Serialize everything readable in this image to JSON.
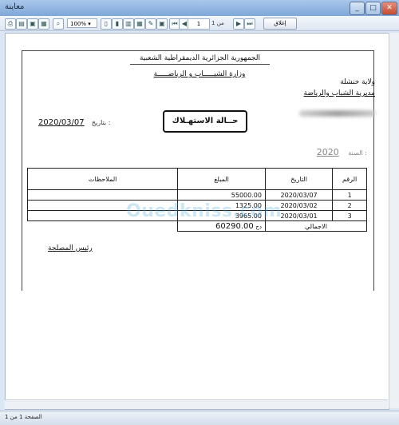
{
  "window": {
    "title": "معاينة",
    "controls": {
      "minimize": "_",
      "maximize": "□",
      "close": "✕"
    }
  },
  "toolbar": {
    "zoom": "100%",
    "page_current": "1",
    "page_of_label": "من 1",
    "close_label": "إغلاق"
  },
  "report": {
    "header_line1": "الجمهورية الجزائرية الديمقراطية الشعبية",
    "header_line2": "وزارة الشبـــــاب و الرياضـــــة",
    "wilaya": "ولاية خنشلة",
    "directorate": "مديرية الشباب والرياضة",
    "title": "حــالة الاستهـلاك",
    "date_label": "بتاريخ :",
    "date_value": "2020/03/07",
    "year_label": "السنة :",
    "year_value": "2020",
    "columns": {
      "num": "الرقم",
      "date": "التاريخ",
      "amount": "المبلغ",
      "notes": "الملاحظات"
    },
    "rows": [
      {
        "num": "1",
        "date": "2020/03/07",
        "amount": "55000.00",
        "notes": ""
      },
      {
        "num": "2",
        "date": "2020/03/02",
        "amount": "1325.00",
        "notes": ""
      },
      {
        "num": "3",
        "date": "2020/03/01",
        "amount": "3965.00",
        "notes": ""
      }
    ],
    "total_label": "الاجمالي",
    "total_value": "60290.00",
    "currency": "دج",
    "chief_label": "رئيس المصلحة"
  },
  "watermark": "Ouedkniss.com",
  "status": {
    "page_info": "الصفحة 1 من 1"
  },
  "colors": {
    "titlebar": "#8fb3df",
    "watermark": "#46aadc"
  }
}
